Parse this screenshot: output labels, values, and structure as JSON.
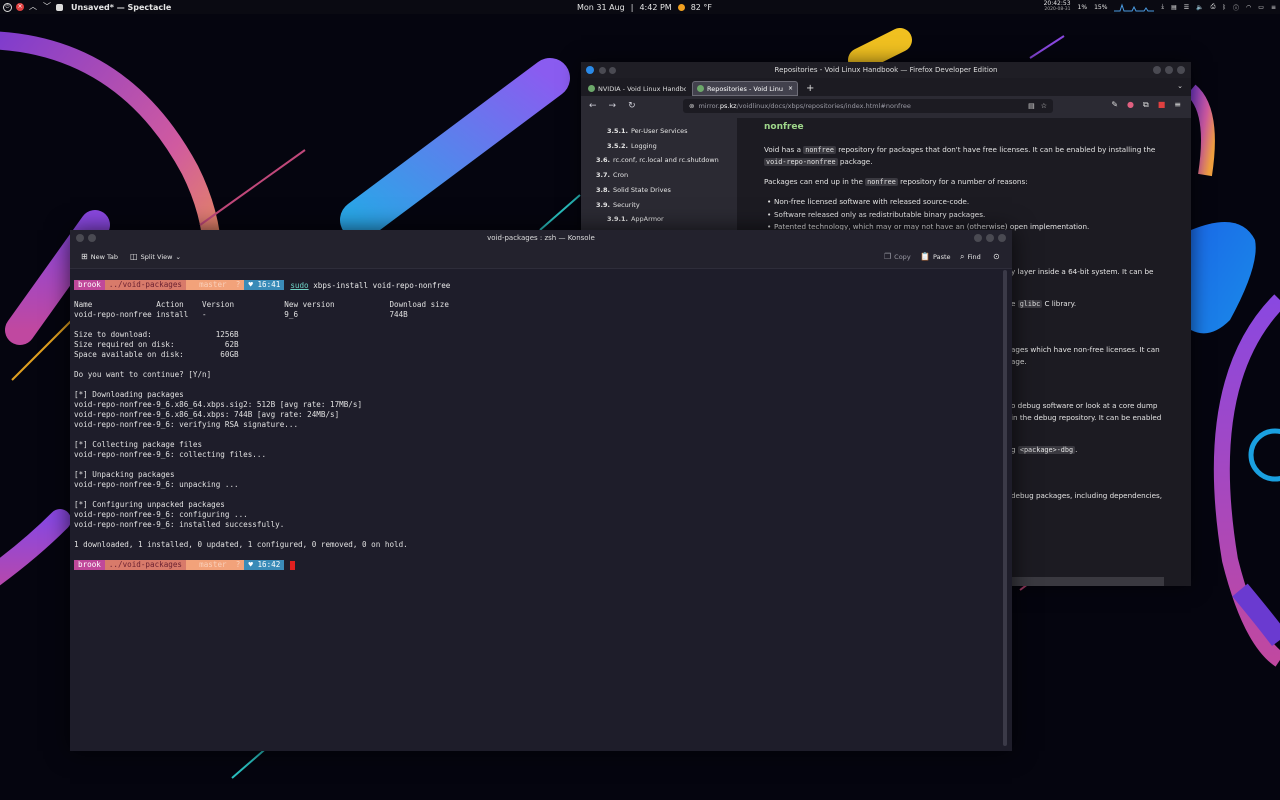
{
  "topbar": {
    "app_title": "Unsaved* — Spectacle",
    "date": "Mon 31 Aug",
    "separator": "|",
    "time": "4:42 PM",
    "weather": "82 °F",
    "clock_time": "20:42:53",
    "clock_date": "2020-08-31",
    "cpu": "1%",
    "mem": "15%"
  },
  "firefox": {
    "title": "Repositories - Void Linux Handbook — Firefox Developer Edition",
    "tabs": [
      {
        "label": "NVIDIA - Void Linux Handbook"
      },
      {
        "label": "Repositories - Void Linux Handbook"
      }
    ],
    "new_tab": "+",
    "url_host_pre": "mirror.",
    "url_host": "ps.kz",
    "url_path": "/voidlinux/docs/xbps/repositories/index.html#nonfree",
    "sidebar": [
      {
        "num": "3.5.1.",
        "label": "Per-User Services"
      },
      {
        "num": "3.5.2.",
        "label": "Logging"
      },
      {
        "num": "3.6.",
        "label": "rc.conf, rc.local and rc.shutdown"
      },
      {
        "num": "3.7.",
        "label": "Cron"
      },
      {
        "num": "3.8.",
        "label": "Solid State Drives"
      },
      {
        "num": "3.9.",
        "label": "Security"
      },
      {
        "num": "3.9.1.",
        "label": "AppArmor"
      }
    ],
    "doc": {
      "heading": "nonfree",
      "p1_a": "Void has a ",
      "p1_code": "nonfree",
      "p1_b": " repository for packages that don't have free licenses. It can be enabled by installing the",
      "p1_code2": "void-repo-nonfree",
      "p1_c": " package.",
      "p2_a": "Packages can end up in the ",
      "p2_code": "nonfree",
      "p2_b": " repository for a number of reasons:",
      "bullets": [
        "Non-free licensed software with released source-code.",
        "Software released only as redistributable binary packages.",
        "Patented technology, which may or may not have an (otherwise) open implementation."
      ],
      "frag1": "y layer inside a 64-bit system. It can be",
      "frag2_a": "e ",
      "frag2_code": "glibc",
      "frag2_b": " C library.",
      "frag3": "ages which have non-free licenses. It can",
      "frag4": "age.",
      "frag5": "o debug software or look at a core dump",
      "frag6": "in the debug repository. It can be enabled",
      "frag7_a": "g ",
      "frag7_code": "<package>-dbg",
      "frag7_b": ".",
      "frag8": "debug packages, including dependencies,"
    }
  },
  "konsole": {
    "title": "void-packages : zsh — Konsole",
    "toolbar": {
      "new_tab": "New Tab",
      "split_view": "Split View",
      "copy": "Copy",
      "paste": "Paste",
      "find": "Find"
    },
    "prompt1": {
      "user": "brook",
      "dir": "../void-packages",
      "git": "  master  ?",
      "time": "16:41"
    },
    "command": {
      "sudo": "sudo",
      "rest": " xbps-install void-repo-nonfree"
    },
    "lines": [
      "Name              Action    Version           New version            Download size",
      "void-repo-nonfree install   -                 9_6                    744B",
      "",
      "Size to download:              1256B",
      "Size required on disk:           62B",
      "Space available on disk:        60GB",
      "",
      "Do you want to continue? [Y/n]",
      "",
      "[*] Downloading packages",
      "void-repo-nonfree-9_6.x86_64.xbps.sig2: 512B [avg rate: 17MB/s]",
      "void-repo-nonfree-9_6.x86_64.xbps: 744B [avg rate: 24MB/s]",
      "void-repo-nonfree-9_6: verifying RSA signature...",
      "",
      "[*] Collecting package files",
      "void-repo-nonfree-9_6: collecting files...",
      "",
      "[*] Unpacking packages",
      "void-repo-nonfree-9_6: unpacking ...",
      "",
      "[*] Configuring unpacked packages",
      "void-repo-nonfree-9_6: configuring ...",
      "void-repo-nonfree-9_6: installed successfully.",
      "",
      "1 downloaded, 1 installed, 0 updated, 1 configured, 0 removed, 0 on hold."
    ],
    "prompt2": {
      "user": "brook",
      "dir": "../void-packages",
      "git": "  master  ?",
      "time": "16:42"
    }
  },
  "colors": {
    "accent_green": "#9ed68a",
    "prompt_user": "#c0489a",
    "prompt_dir": "#d87a6a",
    "prompt_git": "#f2a27a",
    "prompt_time": "#3a8bb8",
    "cursor": "#e02020"
  }
}
